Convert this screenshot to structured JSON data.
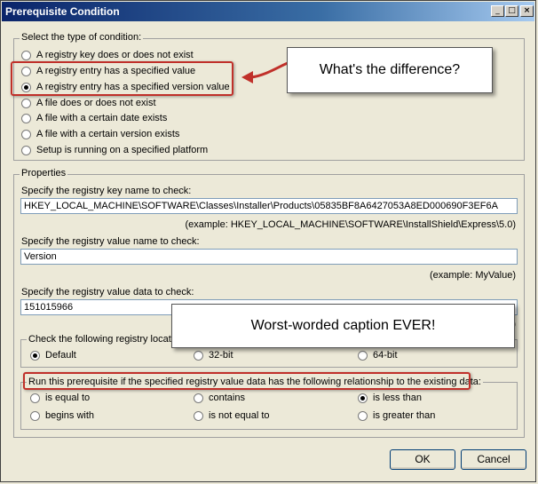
{
  "window": {
    "title": "Prerequisite Condition"
  },
  "condition_type": {
    "legend": "Select the type of condition:",
    "options": [
      {
        "label": "A registry key does or does not exist",
        "selected": false
      },
      {
        "label": "A registry entry has a specified value",
        "selected": false
      },
      {
        "label": "A registry entry has a specified version value",
        "selected": true
      },
      {
        "label": "A file does or does not exist",
        "selected": false
      },
      {
        "label": "A file with a certain date exists",
        "selected": false
      },
      {
        "label": "A file with a certain version exists",
        "selected": false
      },
      {
        "label": "Setup is running on a specified platform",
        "selected": false
      }
    ]
  },
  "properties": {
    "legend": "Properties",
    "key_label": "Specify the registry key name to check:",
    "key_value": "HKEY_LOCAL_MACHINE\\SOFTWARE\\Classes\\Installer\\Products\\05835BF8A6427053A8ED000690F3EF6A",
    "key_example": "(example: HKEY_LOCAL_MACHINE\\SOFTWARE\\InstallShield\\Express\\5.0)",
    "name_label": "Specify the registry value name to check:",
    "name_value": "Version",
    "name_example": "(example: MyValue)",
    "data_label": "Specify the registry value data to check:",
    "data_value": "151015966",
    "data_example_partial": "a)",
    "location": {
      "legend": "Check the following registry locatio",
      "options": [
        {
          "label": "Default",
          "selected": true
        },
        {
          "label": "32-bit",
          "selected": false
        },
        {
          "label": "64-bit",
          "selected": false
        }
      ]
    },
    "relationship": {
      "legend": "Run this prerequisite if the specified registry value data has the following relationship to the existing data:",
      "options": [
        {
          "label": "is equal to",
          "selected": false
        },
        {
          "label": "contains",
          "selected": false
        },
        {
          "label": "is less than",
          "selected": true
        },
        {
          "label": "begins with",
          "selected": false
        },
        {
          "label": "is not equal to",
          "selected": false
        },
        {
          "label": "is greater than",
          "selected": false
        }
      ]
    }
  },
  "buttons": {
    "ok": "OK",
    "cancel": "Cancel"
  },
  "annotations": {
    "callout1": "What's the difference?",
    "callout2": "Worst-worded caption EVER!",
    "highlight_color": "#c0302a"
  }
}
